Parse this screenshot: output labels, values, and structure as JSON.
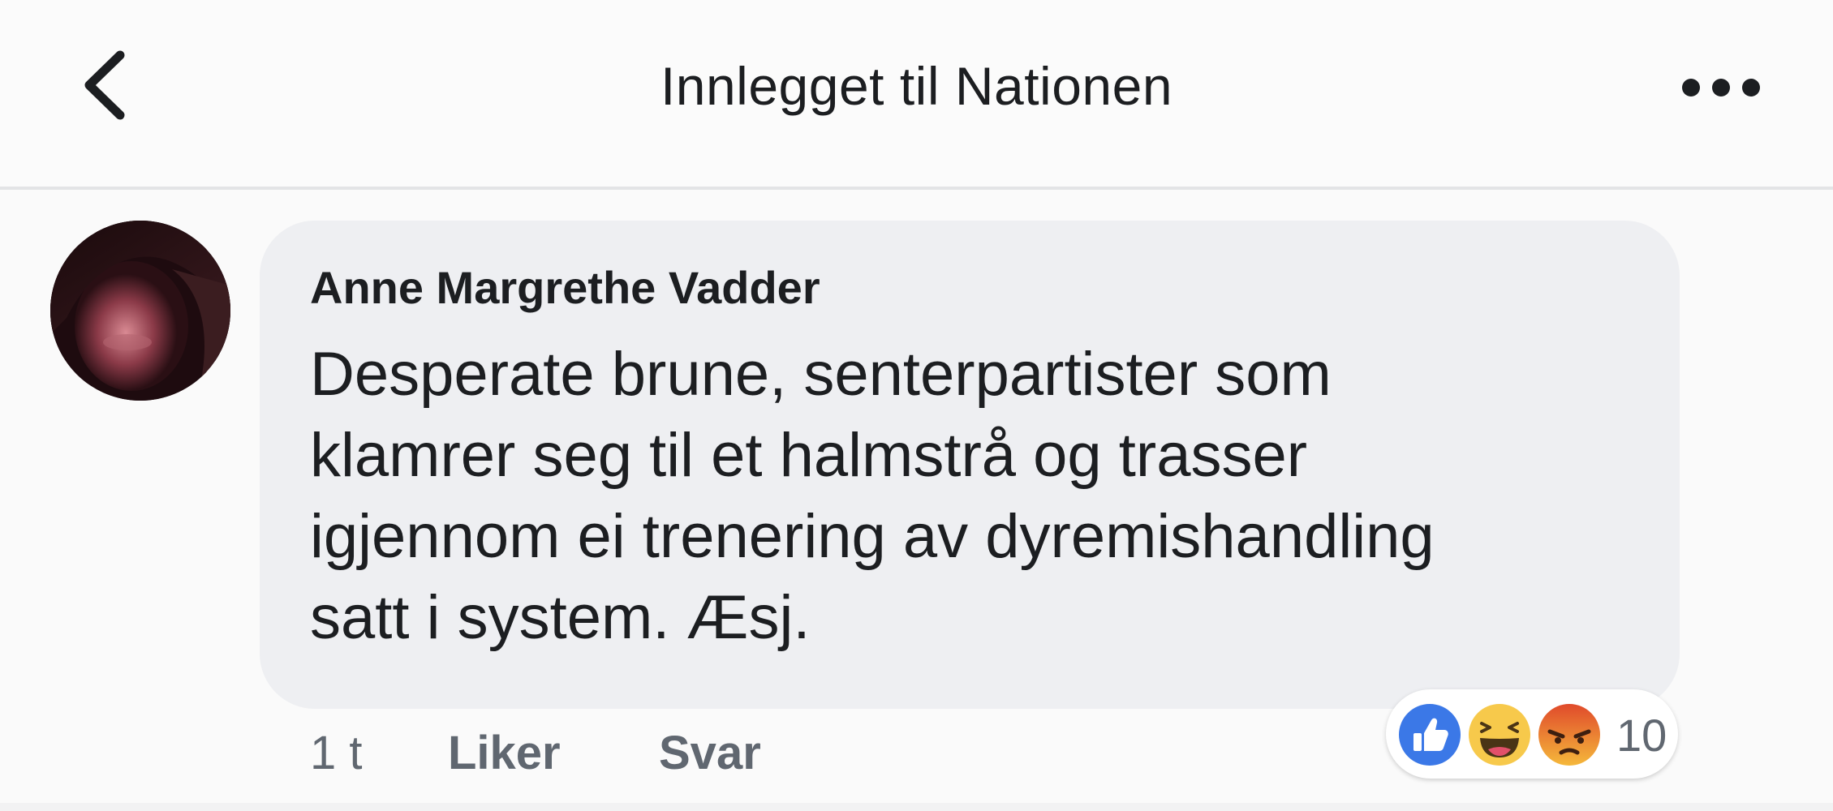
{
  "header": {
    "title": "Innlegget til Nationen",
    "back_icon": "chevron-left-icon",
    "more_icon": "more-horizontal-icon"
  },
  "comment": {
    "author": "Anne Margrethe Vadder",
    "text": "Desperate brune, senterpartister som\nklamrer seg til et halmstrå og trasser\nigjennom ei trenering av dyremishandling\nsatt i system. Æsj.",
    "time": "1 t",
    "like_label": "Liker",
    "reply_label": "Svar",
    "reactions": {
      "icons": [
        "like-reaction-icon",
        "haha-reaction-icon",
        "angry-reaction-icon"
      ],
      "count": "10"
    }
  },
  "colors": {
    "like_blue": "#3b78e7",
    "haha_yellow": "#f7c94b",
    "angry_orange": "#e9710f",
    "bubble_gray": "#eeeff2",
    "meta_gray": "#606770"
  }
}
